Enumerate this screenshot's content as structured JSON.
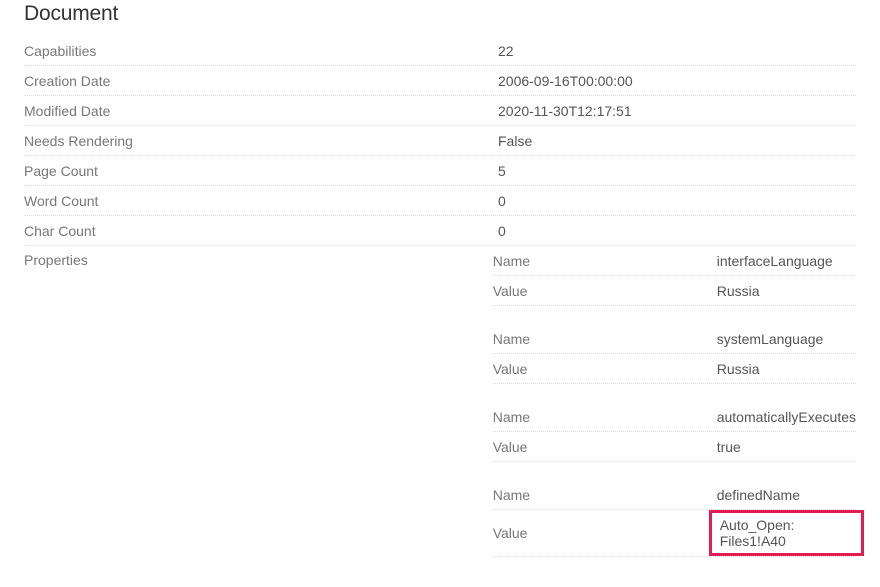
{
  "section_title": "Document",
  "rows": [
    {
      "label": "Capabilities",
      "value": "22"
    },
    {
      "label": "Creation Date",
      "value": "2006-09-16T00:00:00"
    },
    {
      "label": "Modified Date",
      "value": "2020-11-30T12:17:51"
    },
    {
      "label": "Needs Rendering",
      "value": "False"
    },
    {
      "label": "Page Count",
      "value": "5"
    },
    {
      "label": "Word Count",
      "value": "0"
    },
    {
      "label": "Char Count",
      "value": "0"
    }
  ],
  "properties_label": "Properties",
  "kv_labels": {
    "name": "Name",
    "value": "Value"
  },
  "properties": [
    {
      "name": "interfaceLanguage",
      "value": "Russia",
      "highlight": false
    },
    {
      "name": "systemLanguage",
      "value": "Russia",
      "highlight": false
    },
    {
      "name": "automaticallyExecutes",
      "value": "true",
      "highlight": false
    },
    {
      "name": "definedName",
      "value": "Auto_Open: Files1!A40",
      "highlight": true
    }
  ]
}
